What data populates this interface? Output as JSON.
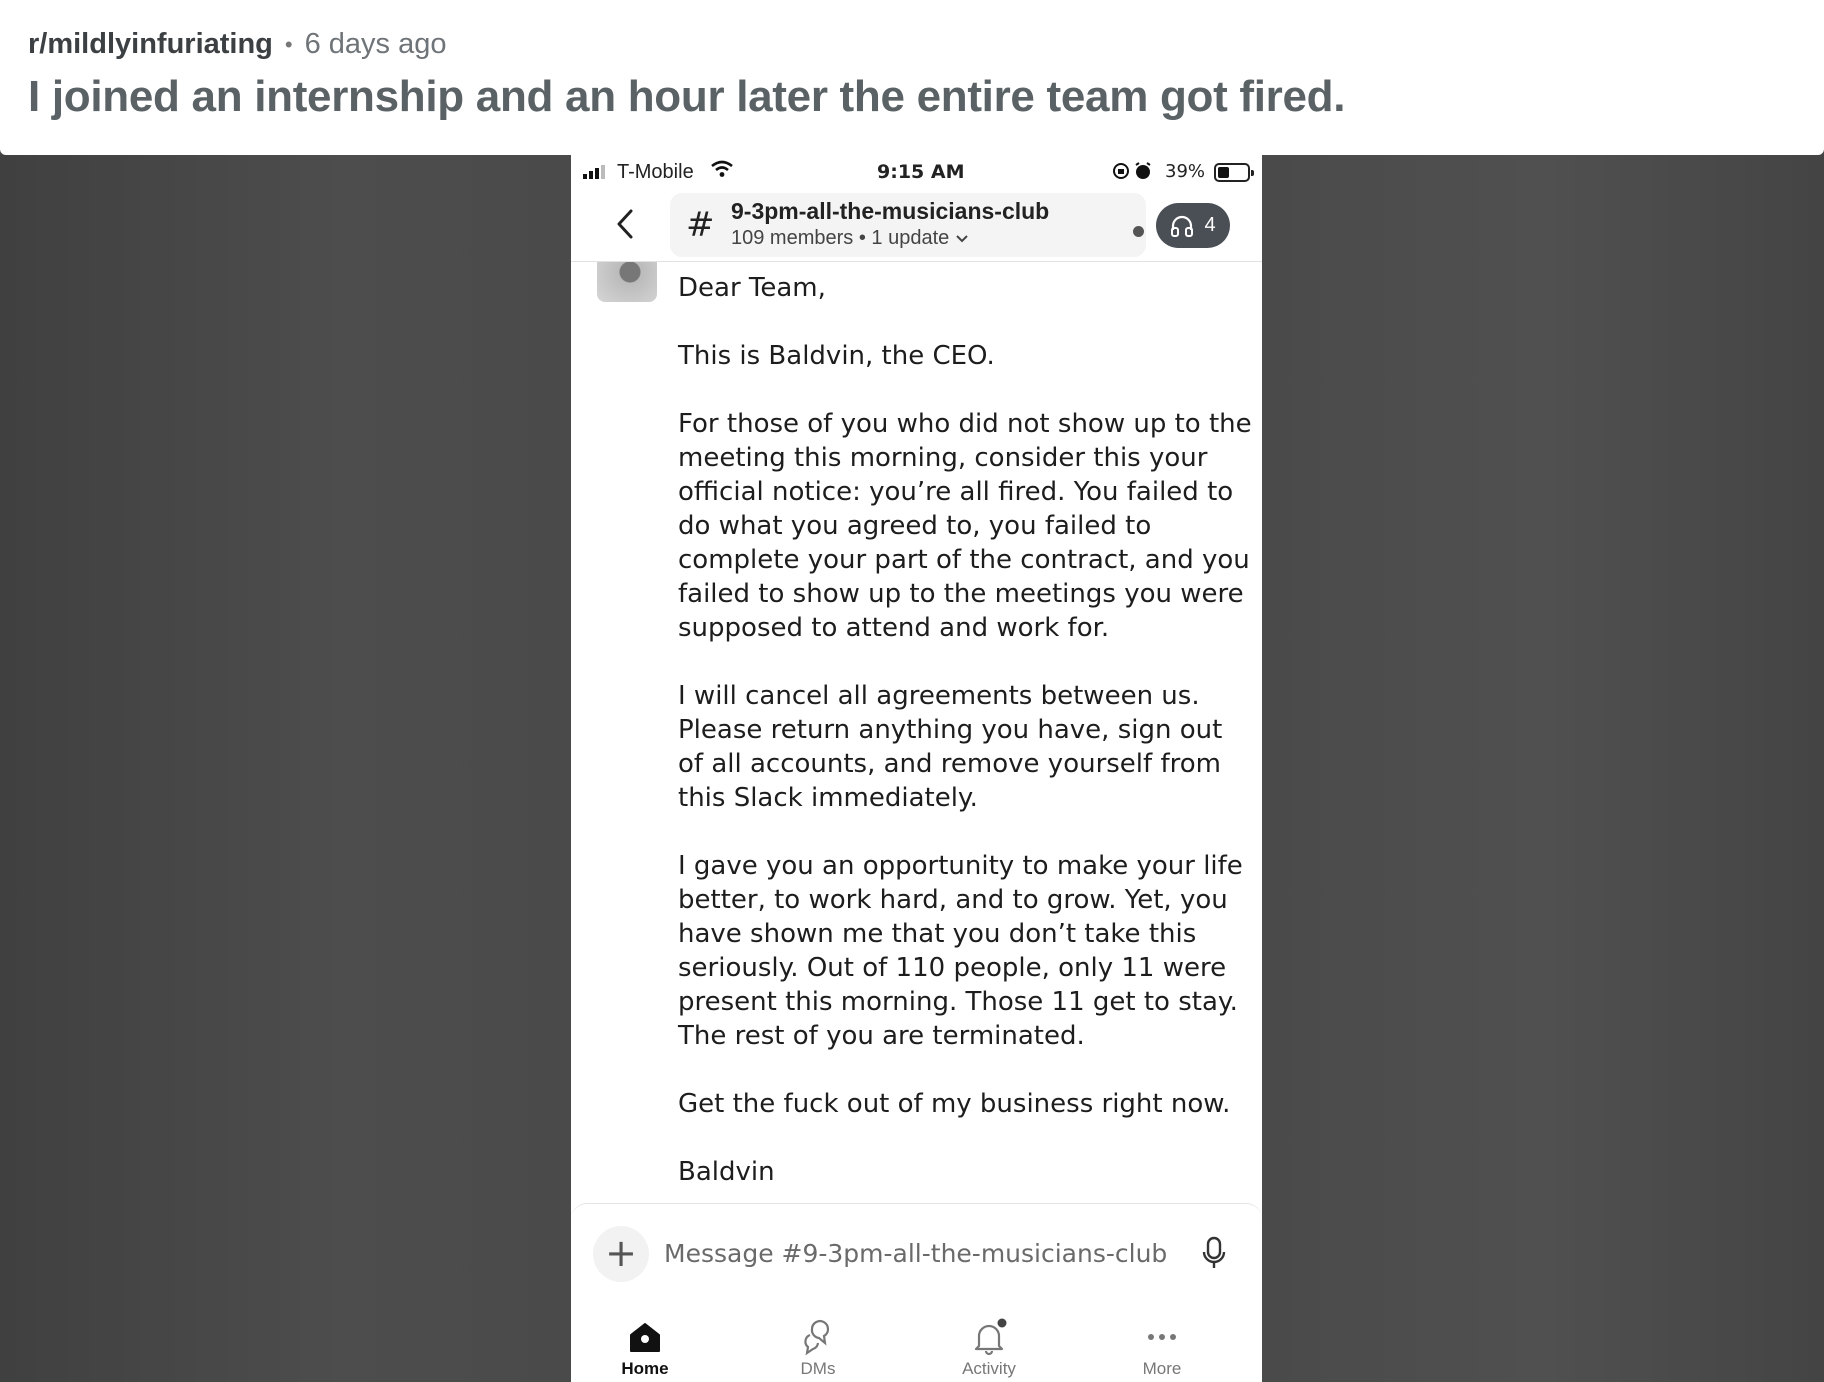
{
  "post": {
    "subreddit": "r/mildlyinfuriating",
    "separator": "•",
    "time": "6 days ago",
    "title": "I joined an internship and an hour later the entire team got fired."
  },
  "status_bar": {
    "carrier": "T-Mobile",
    "time": "9:15 AM",
    "battery": "39%",
    "battery_level": 0.39
  },
  "channel": {
    "name": "9-3pm-all-the-musicians-club",
    "members": "109 members",
    "updates": "1 update",
    "huddle_count": "4"
  },
  "message": {
    "paragraphs": [
      "Dear Team,",
      "This is Baldvin, the CEO.",
      "For those of you who did not show up to the meeting this morning, consider this your official notice: you’re all fired. You failed to do what you agreed to, you failed to complete your part of the contract, and you failed to show up to the meetings you were supposed to attend and work for.",
      "I will cancel all agreements between us. Please return anything you have, sign out of all accounts, and remove yourself from this Slack immediately.",
      "I gave you an opportunity to make your life better, to work hard, and to grow. Yet, you have shown me that you don’t take this seriously. Out of 110 people, only 11 were present this morning. Those 11 get to stay. The rest of you are terminated.",
      "Get the fuck out of my business right now.",
      "Baldvin"
    ]
  },
  "composer": {
    "placeholder": "Message #9-3pm-all-the-musicians-club"
  },
  "tabs": [
    {
      "label": "Home",
      "icon": "home-icon"
    },
    {
      "label": "DMs",
      "icon": "dms-icon"
    },
    {
      "label": "Activity",
      "icon": "bell-icon"
    },
    {
      "label": "More",
      "icon": "more-icon"
    }
  ]
}
